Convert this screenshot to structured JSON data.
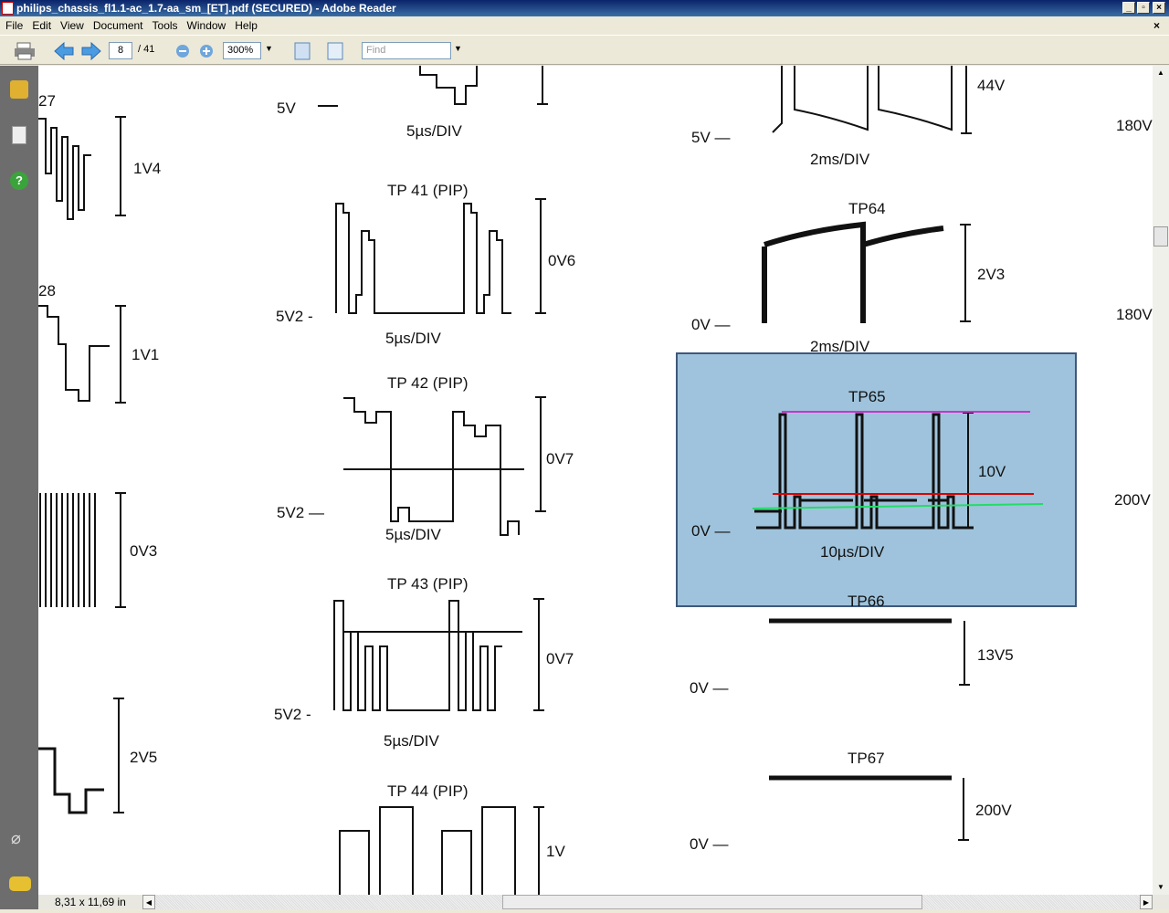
{
  "window": {
    "title": "philips_chassis_fl1.1-ac_1.7-aa_sm_[ET].pdf (SECURED) - Adobe Reader"
  },
  "menu": [
    "File",
    "Edit",
    "View",
    "Document",
    "Tools",
    "Window",
    "Help"
  ],
  "toolbar": {
    "page_current": "8",
    "page_total": "/ 41",
    "zoom": "300%",
    "find_placeholder": "Find"
  },
  "status": {
    "page_size": "8,31 x 11,69 in"
  },
  "highlight_color": "#9fc3dc",
  "lines": {
    "magenta": "#cc33cc",
    "red": "#dd0000",
    "green": "#22dd66"
  },
  "doc": {
    "left": {
      "tp27": "27",
      "v27": "1V4",
      "tp28": "28",
      "v28": "1V1",
      "v3": "0V3",
      "v4": "2V5"
    },
    "middle": {
      "top_ref": "5V",
      "top_div": "5µs/DIV",
      "tp41": "TP 41 (PIP)",
      "tp41_v": "0V6",
      "tp41_ref": "5V2 -",
      "tp41_div": "5µs/DIV",
      "tp42": "TP 42 (PIP)",
      "tp42_v": "0V7",
      "tp42_ref": "5V2 —",
      "tp42_div": "5µs/DIV",
      "tp43": "TP 43 (PIP)",
      "tp43_v": "0V7",
      "tp43_ref": "5V2 -",
      "tp43_div": "5µs/DIV",
      "tp44": "TP 44 (PIP)",
      "tp44_v": "1V"
    },
    "right": {
      "top_v": "44V",
      "top_ref": "5V —",
      "top_div": "2ms/DIV",
      "tp64": "TP64",
      "tp64_v": "2V3",
      "tp64_ref": "0V —",
      "tp64_div": "2ms/DIV",
      "tp65": "TP65",
      "tp65_v": "10V",
      "tp65_ref": "0V —",
      "tp65_div": "10µs/DIV",
      "tp66": "TP66",
      "tp66_v": "13V5",
      "tp66_ref": "0V —",
      "tp67": "TP67",
      "tp67_v": "200V",
      "tp67_ref": "0V —"
    },
    "edge": [
      "180V",
      "180V",
      "200V"
    ]
  }
}
